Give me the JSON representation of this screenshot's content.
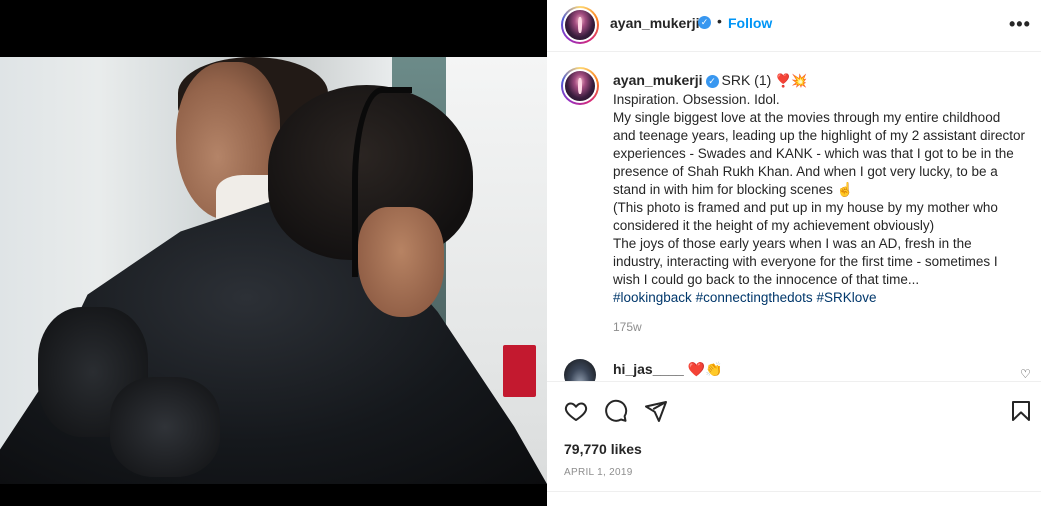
{
  "post": {
    "author": "ayan_mukerji",
    "follow_label": "Follow",
    "separator": "•",
    "more_label": "•••"
  },
  "caption": {
    "author": "ayan_mukerji",
    "headline": "SRK (1)",
    "headline_emojis": "❣️💥",
    "lines": [
      "Inspiration. Obsession. Idol.",
      "My single biggest love at the movies through my entire childhood and teenage years, leading up the highlight of my 2 assistant director experiences - Swades and KANK - which was that I got to be in the presence of Shah Rukh Khan. And when I got very lucky, to be a stand in with him for blocking scenes ☝️",
      "(This photo is framed and put up in my house by my mother who considered it the height of my achievement obviously)",
      "The joys of those early years when I was an AD, fresh in the industry, interacting with everyone for the first time - sometimes I wish I could go back to the innocence of that time..."
    ],
    "hashtags": [
      "#lookingback",
      "#connectingthedots",
      "#SRKlove"
    ],
    "age": "175w"
  },
  "comment": {
    "author": "hi_jas____",
    "text": "❤️👏"
  },
  "actions": {
    "like_icon": "heart-icon",
    "comment_icon": "comment-icon",
    "share_icon": "share-icon",
    "save_icon": "bookmark-icon",
    "likes": "79,770 likes",
    "date": "APRIL 1, 2019"
  },
  "colors": {
    "link": "#0095f6",
    "hashtag": "#00376b",
    "verified": "#3897f0",
    "muted": "#8e8e8e",
    "text": "#262626"
  }
}
